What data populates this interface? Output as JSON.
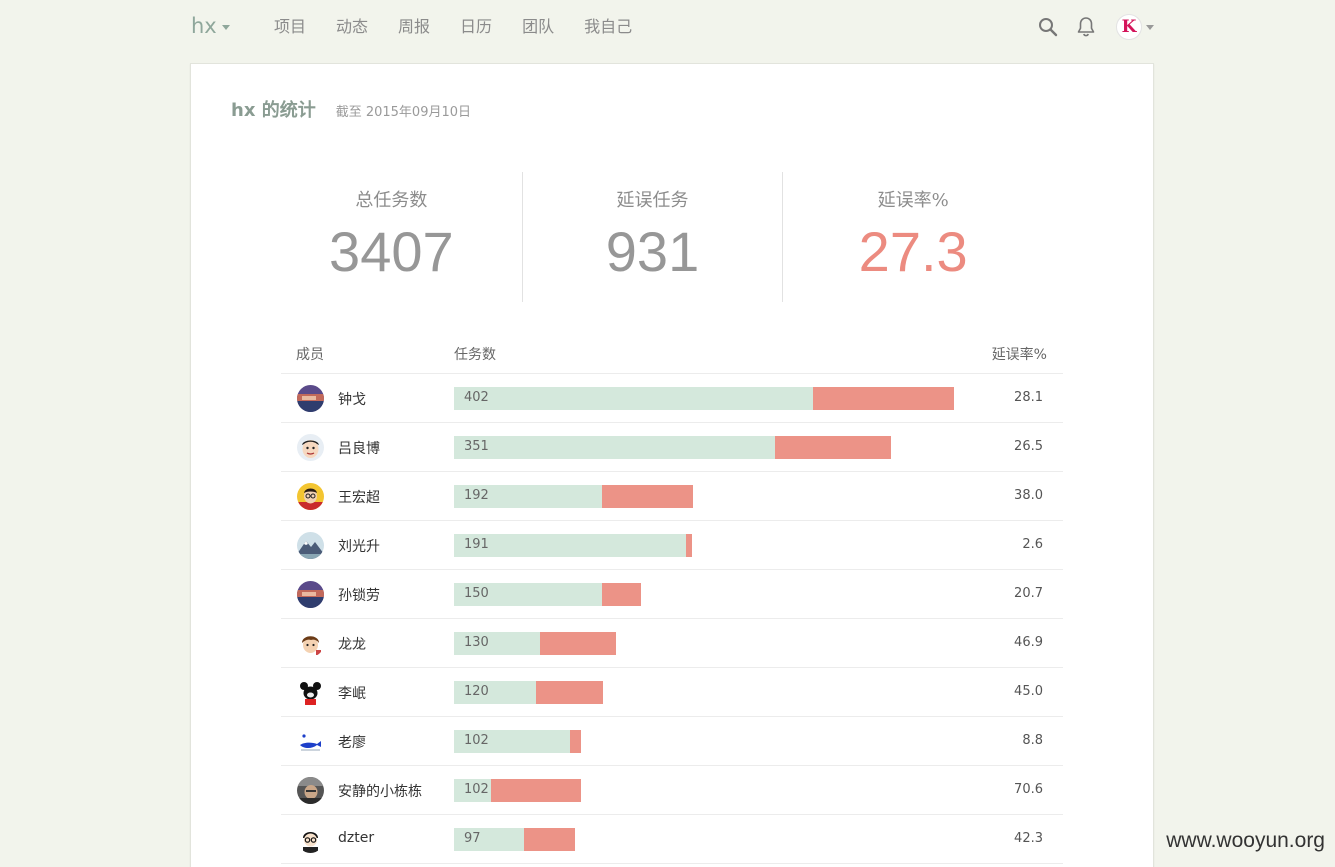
{
  "nav": {
    "brand": "hx",
    "items": [
      "项目",
      "动态",
      "周报",
      "日历",
      "团队",
      "我自己"
    ],
    "avatar_letter": "K"
  },
  "stats_page": {
    "title": "hx 的统计",
    "date": "截至 2015年09月10日"
  },
  "stats": [
    {
      "label": "总任务数",
      "value": "3407"
    },
    {
      "label": "延误任务",
      "value": "931"
    },
    {
      "label": "延误率%",
      "value": "27.3"
    }
  ],
  "table": {
    "headers": {
      "member": "成员",
      "tasks": "任务数",
      "rate": "延误率%"
    },
    "rows": [
      {
        "name": "钟戈",
        "tasks": 402,
        "rate": "28.1",
        "avatar": "landscape-avatar"
      },
      {
        "name": "吕良博",
        "tasks": 351,
        "rate": "26.5",
        "avatar": "cartoon-face-avatar"
      },
      {
        "name": "王宏超",
        "tasks": 192,
        "rate": "38.0",
        "avatar": "glasses-avatar"
      },
      {
        "name": "刘光升",
        "tasks": 191,
        "rate": "2.6",
        "avatar": "mountain-avatar"
      },
      {
        "name": "孙锁劳",
        "tasks": 150,
        "rate": "20.7",
        "avatar": "landscape-avatar"
      },
      {
        "name": "龙龙",
        "tasks": 130,
        "rate": "46.9",
        "avatar": "boy-avatar"
      },
      {
        "name": "李岷",
        "tasks": 120,
        "rate": "45.0",
        "avatar": "bear-avatar"
      },
      {
        "name": "老廖",
        "tasks": 102,
        "rate": "8.8",
        "avatar": "whale-avatar"
      },
      {
        "name": "安静的小栋栋",
        "tasks": 102,
        "rate": "70.6",
        "avatar": "photo-avatar"
      },
      {
        "name": "dzter",
        "tasks": 97,
        "rate": "42.3",
        "avatar": "nerd-avatar"
      }
    ],
    "max_tasks": 402
  },
  "colors": {
    "ok_bar": "#d4e8dc",
    "delay_bar": "#ec9387",
    "accent": "#ec8b80",
    "brand": "#8fa79b"
  },
  "watermark": "www.wooyun.org"
}
